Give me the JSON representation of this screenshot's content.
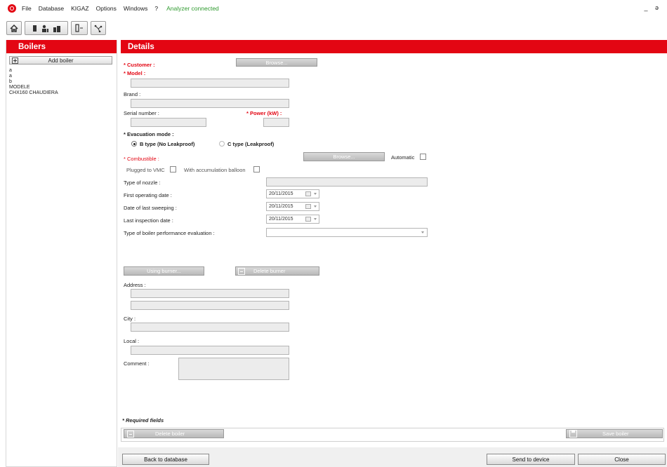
{
  "menu": {
    "items": [
      "File",
      "Database",
      "KIGAZ",
      "Options",
      "Windows",
      "?"
    ],
    "status": "Analyzer connected",
    "window_controls": "_ ə"
  },
  "toolbar": {
    "icons": [
      "home-icon",
      "device-icon",
      "technician-icon",
      "building-icon",
      "analyzer-probe-icon",
      "network-icon"
    ]
  },
  "left_panel": {
    "title": "Boilers",
    "add_button": "Add boiler",
    "boilers": [
      "a",
      "a",
      "b",
      "MODELE",
      "CHX160 CHAUDIERA"
    ]
  },
  "details": {
    "title": "Details",
    "customer_label": "* Customer :",
    "customer_browse": "Browse...",
    "model_label": "* Model :",
    "brand_label": "Brand :",
    "serial_label": "Serial number :",
    "power_label": "* Power (kW) :",
    "evacuation_label": "* Evacuation mode :",
    "evacuation_options": [
      "B type (No Leakproof)",
      "C type (Leakproof)"
    ],
    "evacuation_selected": "B type (No Leakproof)",
    "combustible_label": "* Combustible :",
    "combustible_browse": "Browse...",
    "automatic_label": "Automatic",
    "plugged_vmc_label": "Plugged to VMC",
    "accumulation_label": "With accumulation balloon",
    "nozzle_label": "Type of nozzle :",
    "first_operating_label": "First operating date :",
    "first_operating_value": "20/11/2015",
    "last_sweeping_label": "Date of last sweeping :",
    "last_sweeping_value": "20/11/2015",
    "last_inspection_label": "Last inspection date :",
    "last_inspection_value": "20/11/2015",
    "performance_label": "Type of boiler performance evaluation :",
    "using_burner": "Using burner...",
    "delete_burner": "Delete burner",
    "address_label": "Address :",
    "city_label": "City :",
    "local_label": "Local :",
    "comment_label": "Comment :",
    "required_note": "* Required fields",
    "delete_boiler": "Delete boiler",
    "save_boiler": "Save boiler"
  },
  "footer": {
    "back": "Back to database",
    "send": "Send to device",
    "close": "Close"
  },
  "colors": {
    "brand_red": "#e30613",
    "status_green": "#2e9a2e"
  }
}
